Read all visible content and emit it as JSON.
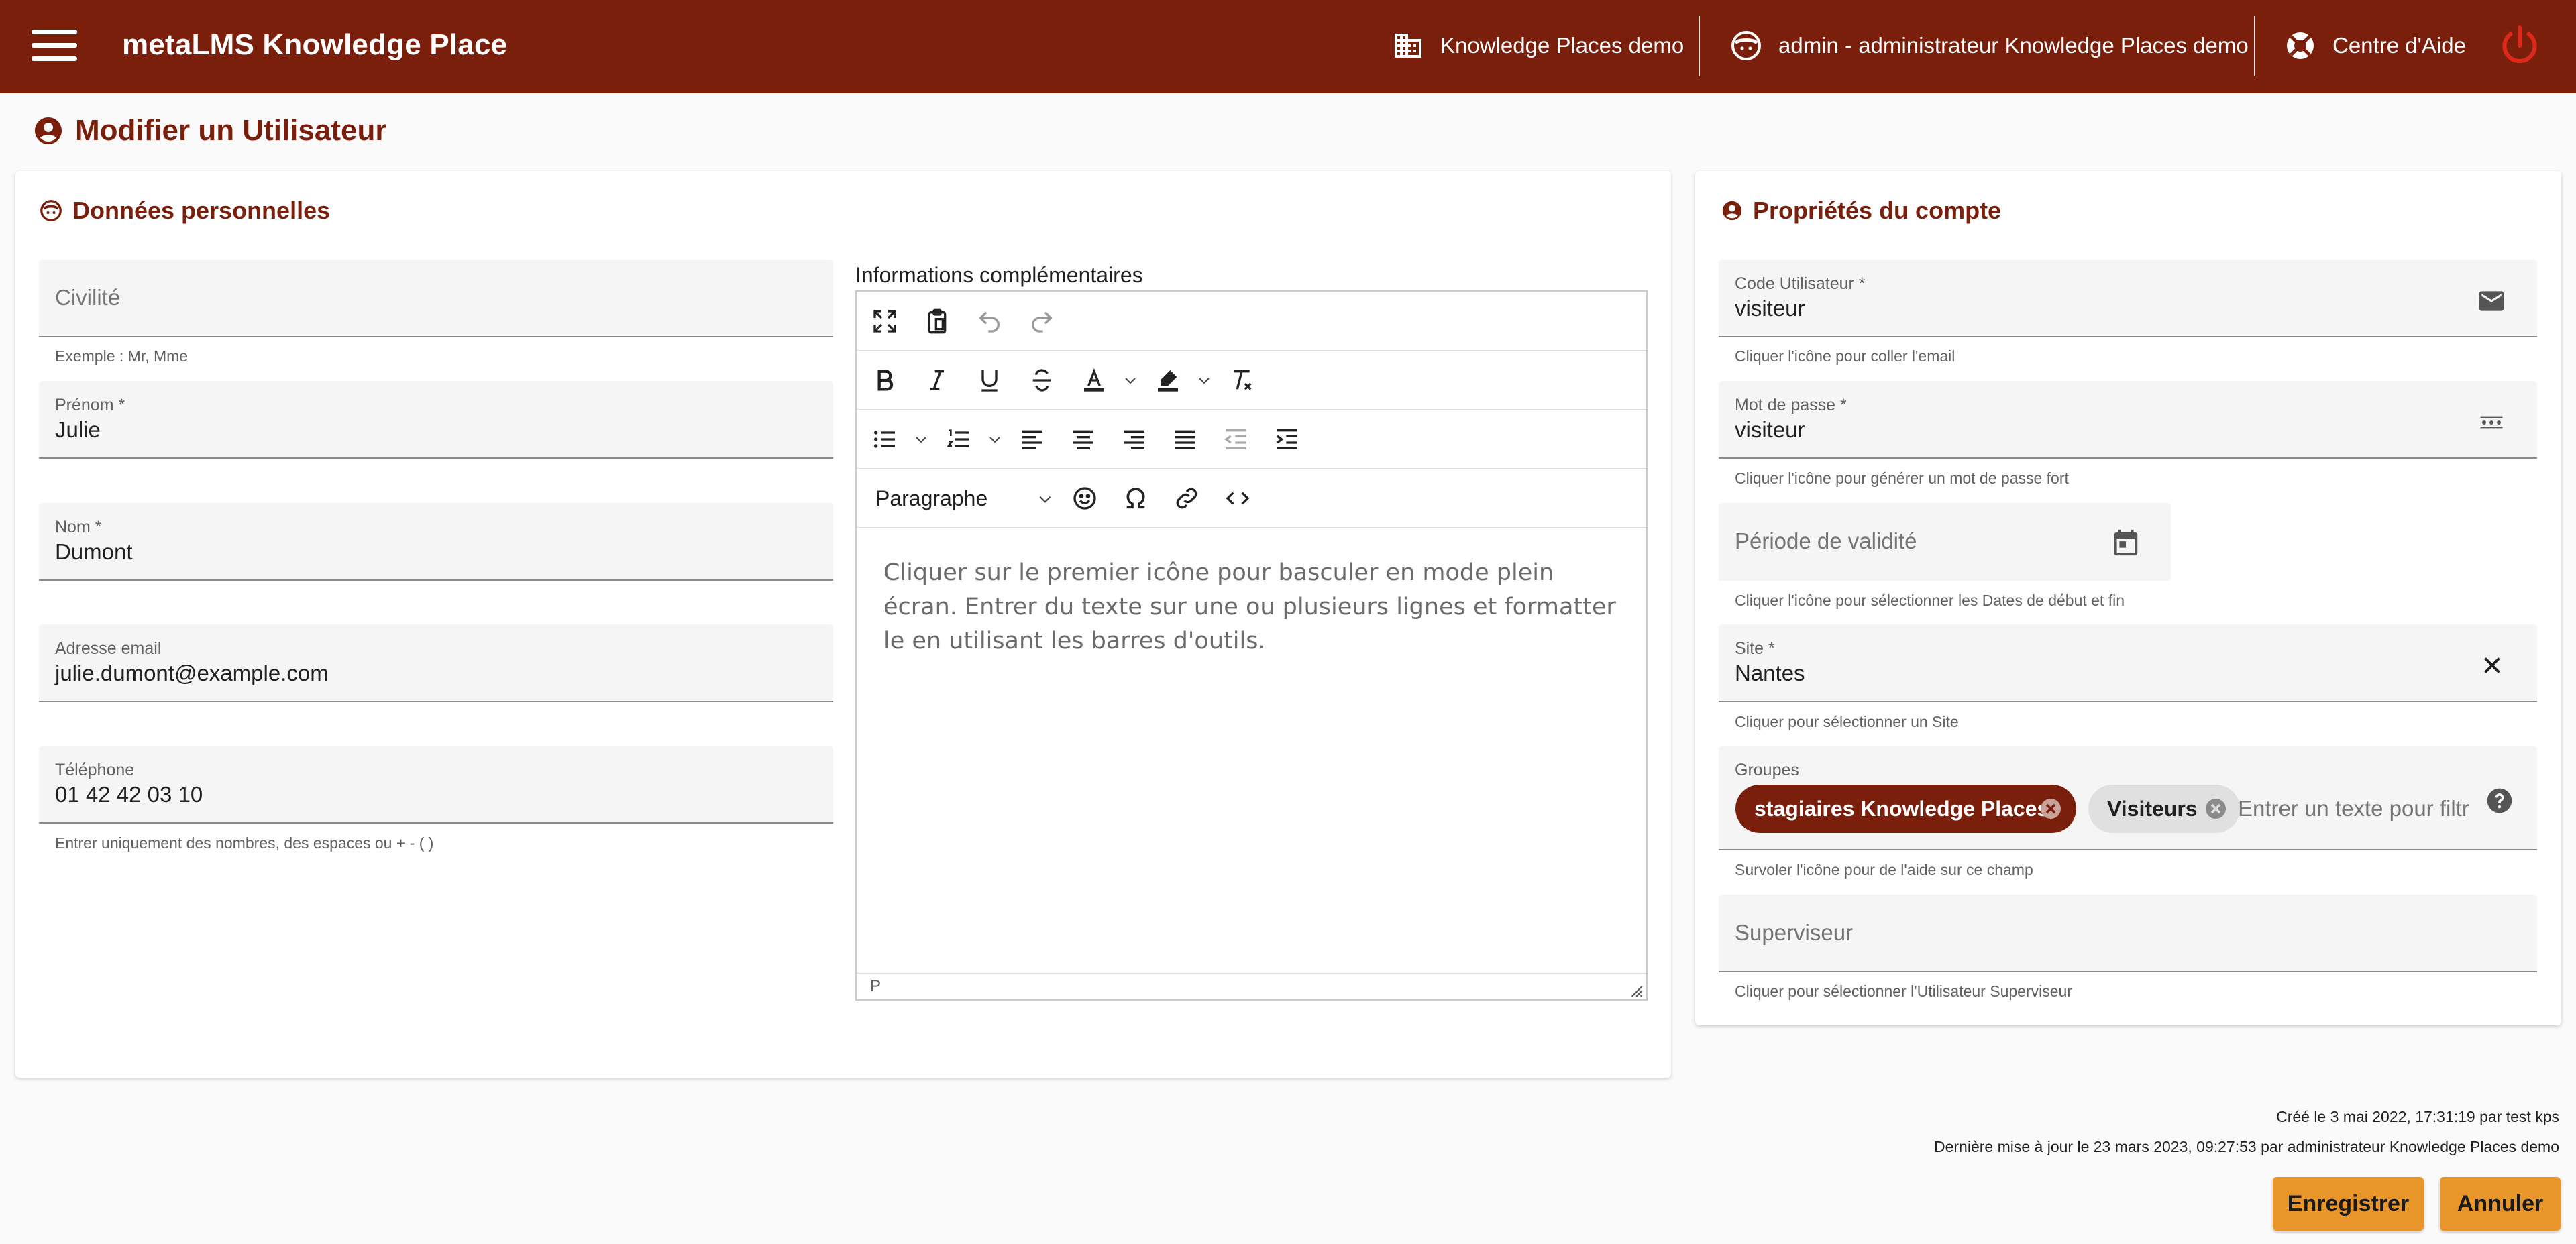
{
  "app": {
    "title": "metaLMS Knowledge Place",
    "place": "Knowledge Places demo",
    "user": "admin - administrateur Knowledge Places demo",
    "help": "Centre d'Aide"
  },
  "page": {
    "title": "Modifier un Utilisateur"
  },
  "personal": {
    "title": "Données personnelles",
    "civilite": {
      "placeholder": "Civilité",
      "hint": "Exemple : Mr, Mme"
    },
    "prenom": {
      "label": "Prénom *",
      "value": "Julie"
    },
    "nom": {
      "label": "Nom *",
      "value": "Dumont"
    },
    "email": {
      "label": "Adresse email",
      "value": "julie.dumont@example.com"
    },
    "telephone": {
      "label": "Téléphone",
      "value": "01 42 42 03 10",
      "hint": "Entrer uniquement des nombres, des espaces ou + - ( )"
    }
  },
  "editor": {
    "label": "Informations complémentaires",
    "format": "Paragraphe",
    "placeholder": "Cliquer sur le premier icône pour basculer en mode plein écran. Entrer du texte sur une ou plusieurs lignes et formatter le en utilisant les barres d'outils.",
    "status_path": "P"
  },
  "account": {
    "title": "Propriétés du compte",
    "code": {
      "label": "Code Utilisateur *",
      "value": "visiteur",
      "hint": "Cliquer l'icône pour coller l'email"
    },
    "password": {
      "label": "Mot de passe *",
      "value": "visiteur",
      "hint": "Cliquer l'icône pour générer un mot de passe fort"
    },
    "validity": {
      "placeholder": "Période de validité",
      "hint": "Cliquer l'icône pour sélectionner les Dates de début et fin"
    },
    "site": {
      "label": "Site *",
      "value": "Nantes",
      "hint": "Cliquer pour sélectionner un Site"
    },
    "groups": {
      "label": "Groupes",
      "chips": [
        "stagiaires Knowledge Places",
        "Visiteurs"
      ],
      "placeholder": "Entrer un texte pour filtrer",
      "hint": "Survoler l'icône pour de l'aide sur ce champ"
    },
    "supervisor": {
      "placeholder": "Superviseur",
      "hint": "Cliquer pour sélectionner l'Utilisateur Superviseur"
    }
  },
  "meta": {
    "created": "Créé le 3 mai 2022, 17:31:19 par test kps",
    "updated": "Dernière mise à jour le 23 mars 2023, 09:27:53 par administrateur Knowledge Places demo"
  },
  "actions": {
    "save": "Enregistrer",
    "cancel": "Annuler"
  },
  "colors": {
    "brand": "#7b1f0d",
    "accent_button": "#e8962a",
    "chip_secondary": "#e0e0e0"
  }
}
